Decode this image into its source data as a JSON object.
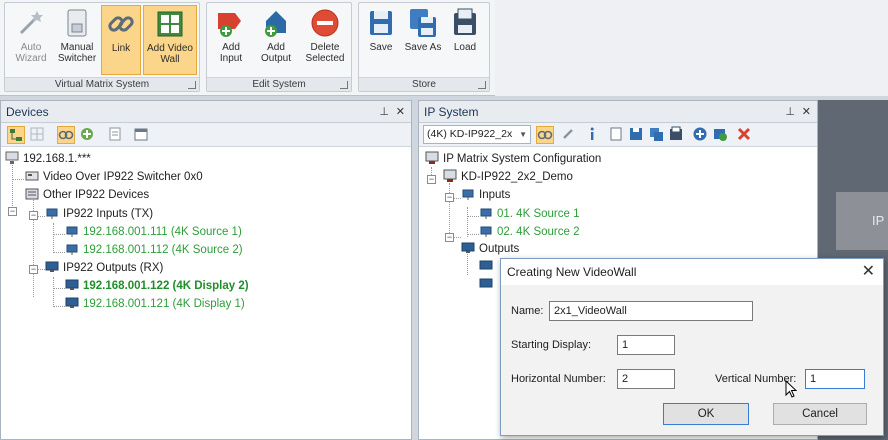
{
  "ribbon": {
    "groups": [
      {
        "label": "Virtual Matrix System",
        "buttons": [
          {
            "label": "Auto Wizard",
            "icon": "wand-icon",
            "state": "disabled"
          },
          {
            "label": "Manual Switcher",
            "icon": "switcher-icon",
            "state": "normal"
          },
          {
            "label": "Link",
            "icon": "link-icon",
            "state": "active"
          },
          {
            "label": "Add Video Wall",
            "icon": "video-wall-icon",
            "state": "active"
          }
        ]
      },
      {
        "label": "Edit System",
        "buttons": [
          {
            "label": "Add Input",
            "icon": "add-input-icon",
            "state": "normal"
          },
          {
            "label": "Add Output",
            "icon": "add-output-icon",
            "state": "normal"
          },
          {
            "label": "Delete Selected",
            "icon": "delete-icon",
            "state": "normal"
          }
        ]
      },
      {
        "label": "Store",
        "buttons": [
          {
            "label": "Save",
            "icon": "save-icon",
            "state": "normal"
          },
          {
            "label": "Save As",
            "icon": "save-as-icon",
            "state": "normal"
          },
          {
            "label": "Load",
            "icon": "load-icon",
            "state": "normal"
          }
        ]
      }
    ]
  },
  "devices_panel": {
    "title": "Devices",
    "pin": "ꟷ",
    "close": "✕",
    "tree": [
      {
        "label": "192.168.1.***",
        "style": "normal"
      },
      {
        "label": "Video Over IP922 Switcher 0x0",
        "style": "normal"
      },
      {
        "label": "Other IP922 Devices",
        "style": "normal"
      },
      {
        "label": "IP922 Inputs (TX)",
        "style": "normal"
      },
      {
        "label": "192.168.001.111 (4K Source 1)",
        "style": "green"
      },
      {
        "label": "192.168.001.112 (4K Source 2)",
        "style": "green"
      },
      {
        "label": "IP922 Outputs (RX)",
        "style": "normal"
      },
      {
        "label": "192.168.001.122 (4K Display 2)",
        "style": "bold-green"
      },
      {
        "label": "192.168.001.121 (4K Display 1)",
        "style": "green"
      }
    ]
  },
  "ip_panel": {
    "title": "IP System",
    "combo_value": "(4K) KD-IP922_2x",
    "tree": [
      {
        "label": "IP Matrix System Configuration",
        "style": "normal"
      },
      {
        "label": "KD-IP922_2x2_Demo",
        "style": "normal"
      },
      {
        "label": "Inputs",
        "style": "normal"
      },
      {
        "label": "01. 4K Source 1",
        "style": "green"
      },
      {
        "label": "02. 4K Source 2",
        "style": "green"
      },
      {
        "label": "Outputs",
        "style": "normal"
      }
    ]
  },
  "side_tile": "IP",
  "dialog": {
    "title": "Creating New VideoWall",
    "name_label": "Name:",
    "name_value": "2x1_VideoWall",
    "start_label": "Starting Display:",
    "start_value": "1",
    "horiz_label": "Horizontal Number:",
    "horiz_value": "2",
    "vert_label": "Vertical Number:",
    "vert_value": "1",
    "ok_label": "OK",
    "cancel_label": "Cancel"
  },
  "colors": {
    "active": "#fbd68a",
    "green_text": "#2e9d3a",
    "dialog_border": "#7e9dc4"
  }
}
